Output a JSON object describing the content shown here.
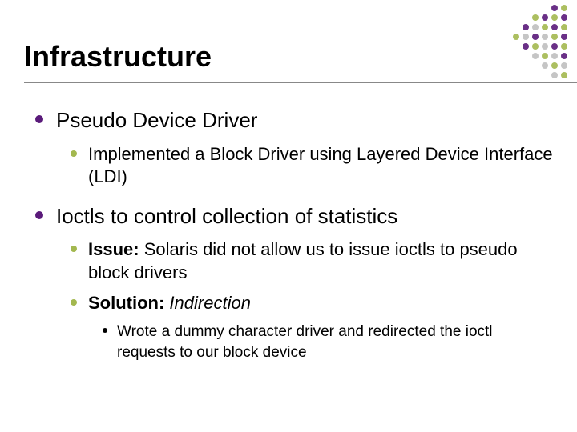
{
  "title": "Infrastructure",
  "bullets": [
    {
      "text": "Pseudo Device Driver",
      "children": [
        {
          "text": "Implemented a Block Driver using Layered Device Interface (LDI)"
        }
      ]
    },
    {
      "text": "Ioctls to control collection of statistics",
      "children": [
        {
          "label": "Issue:",
          "rest": " Solaris did not allow us to issue ioctls to pseudo block drivers"
        },
        {
          "label": "Solution:",
          "rest_italic": " Indirection",
          "children": [
            {
              "text": "Wrote a dummy character driver and redirected the ioctl requests to our block device"
            }
          ]
        }
      ]
    }
  ],
  "dot_colors": {
    "purple": "#5a1a7a",
    "olive": "#a3b84f",
    "gray": "#bfbfbf"
  },
  "dot_pattern": [
    [
      "",
      "",
      "",
      "",
      "",
      "",
      "purple",
      "olive"
    ],
    [
      "",
      "",
      "",
      "",
      "olive",
      "purple",
      "olive",
      "purple"
    ],
    [
      "",
      "",
      "",
      "purple",
      "gray",
      "olive",
      "purple",
      "olive"
    ],
    [
      "",
      "",
      "olive",
      "gray",
      "purple",
      "gray",
      "olive",
      "purple"
    ],
    [
      "",
      "",
      "",
      "purple",
      "olive",
      "gray",
      "purple",
      "olive"
    ],
    [
      "",
      "",
      "",
      "",
      "gray",
      "olive",
      "gray",
      "purple"
    ],
    [
      "",
      "",
      "",
      "",
      "",
      "gray",
      "olive",
      "gray"
    ],
    [
      "",
      "",
      "",
      "",
      "",
      "",
      "gray",
      "olive"
    ]
  ]
}
